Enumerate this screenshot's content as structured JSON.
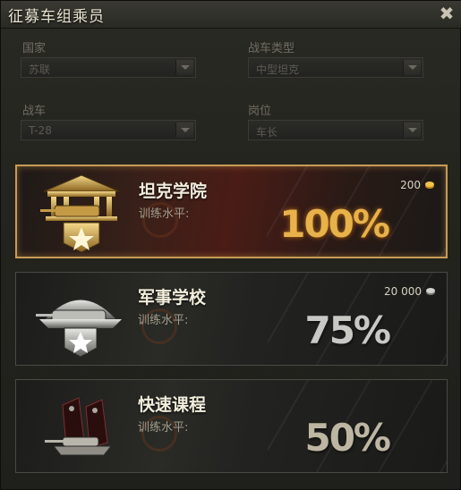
{
  "window": {
    "title": "征募车组乘员"
  },
  "filters": {
    "nation": {
      "label": "国家",
      "value": "苏联"
    },
    "tank_type": {
      "label": "战车类型",
      "value": "中型坦克"
    },
    "vehicle": {
      "label": "战车",
      "value": "T-28"
    },
    "role": {
      "label": "岗位",
      "value": "车长"
    }
  },
  "options": [
    {
      "title": "坦克学院",
      "sub": "训练水平:",
      "cost": "200",
      "currency_icon": "gold-coin-icon",
      "percent": "100%",
      "selected": true
    },
    {
      "title": "军事学校",
      "sub": "训练水平:",
      "cost": "20 000",
      "currency_icon": "silver-coin-icon",
      "percent": "75%",
      "selected": false
    },
    {
      "title": "快速课程",
      "sub": "训练水平:",
      "cost": "",
      "currency_icon": "",
      "percent": "50%",
      "selected": false
    }
  ],
  "colors": {
    "accent_gold": "#e8b24a",
    "selected_border": "#c79b55"
  }
}
